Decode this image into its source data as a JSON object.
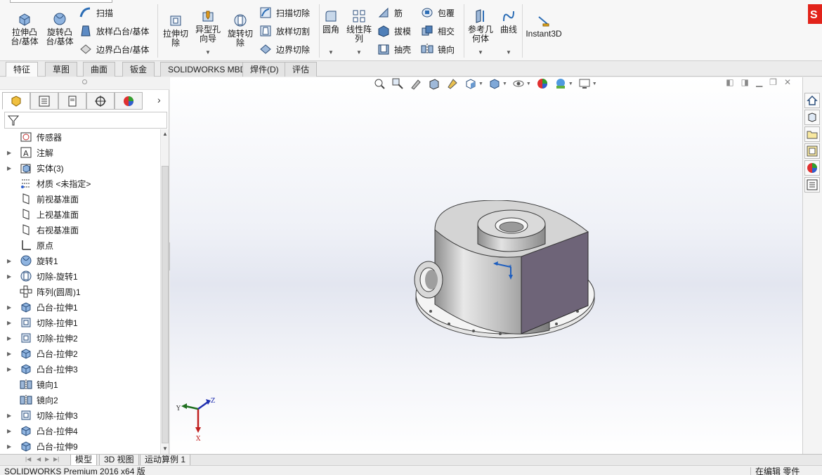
{
  "ribbon": {
    "extrude_boss": "拉伸凸\n台/基体",
    "revolve_boss": "旋转凸\n台/基体",
    "sweep": "扫描",
    "loft_boss": "放样凸台/基体",
    "boundary_boss": "边界凸台/基体",
    "extruded_cut": "拉伸切\n除",
    "hole_wizard": "异型孔\n向导",
    "revolved_cut": "旋转切\n除",
    "swept_cut": "扫描切除",
    "lofted_cut": "放样切割",
    "boundary_cut": "边界切除",
    "fillet": "圆角",
    "linear_pattern": "线性阵\n列",
    "rib": "筋",
    "draft": "拔模",
    "shell": "抽壳",
    "wrap": "包覆",
    "intersect": "相交",
    "mirror": "镜向",
    "ref_geometry": "参考几\n何体",
    "curves": "曲线",
    "instant3d": "Instant3D"
  },
  "tabs": [
    "特征",
    "草图",
    "曲面",
    "钣金",
    "SOLIDWORKS MBD",
    "焊件(D)",
    "评估"
  ],
  "active_tab": "特征",
  "tree": [
    {
      "label": "传感器",
      "icon": "sensor-icon",
      "expandable": false
    },
    {
      "label": "注解",
      "icon": "annotation-icon",
      "expandable": true
    },
    {
      "label": "实体(3)",
      "icon": "solid-bodies-icon",
      "expandable": true
    },
    {
      "label": "材质 <未指定>",
      "icon": "material-icon",
      "expandable": false
    },
    {
      "label": "前视基准面",
      "icon": "plane-icon",
      "expandable": false
    },
    {
      "label": "上视基准面",
      "icon": "plane-icon",
      "expandable": false
    },
    {
      "label": "右视基准面",
      "icon": "plane-icon",
      "expandable": false
    },
    {
      "label": "原点",
      "icon": "origin-icon",
      "expandable": false
    },
    {
      "label": "旋转1",
      "icon": "revolve-icon",
      "expandable": true
    },
    {
      "label": "切除-旋转1",
      "icon": "cut-revolve-icon",
      "expandable": true
    },
    {
      "label": "阵列(圆周)1",
      "icon": "circular-pattern-icon",
      "expandable": false
    },
    {
      "label": "凸台-拉伸1",
      "icon": "boss-extrude-icon",
      "expandable": true
    },
    {
      "label": "切除-拉伸1",
      "icon": "cut-extrude-icon",
      "expandable": true
    },
    {
      "label": "切除-拉伸2",
      "icon": "cut-extrude-icon",
      "expandable": true
    },
    {
      "label": "凸台-拉伸2",
      "icon": "boss-extrude-icon",
      "expandable": true
    },
    {
      "label": "凸台-拉伸3",
      "icon": "boss-extrude-icon",
      "expandable": true
    },
    {
      "label": "镜向1",
      "icon": "mirror-icon",
      "expandable": false
    },
    {
      "label": "镜向2",
      "icon": "mirror-icon",
      "expandable": false
    },
    {
      "label": "切除-拉伸3",
      "icon": "cut-extrude-icon",
      "expandable": true
    },
    {
      "label": "凸台-拉伸4",
      "icon": "boss-extrude-icon",
      "expandable": true
    },
    {
      "label": "凸台-拉伸9",
      "icon": "boss-extrude-icon",
      "expandable": true
    }
  ],
  "triad": {
    "x": "X",
    "y": "Y",
    "z": "Z"
  },
  "bottom_tabs": [
    "模型",
    "3D 视图",
    "运动算例 1"
  ],
  "status": {
    "left": "SOLIDWORKS Premium 2016 x64 版",
    "right": "在编辑 零件"
  },
  "colors": {
    "accent": "#1f5fbf",
    "model_face": "#c9c9c9",
    "model_side": "#6e6478"
  }
}
